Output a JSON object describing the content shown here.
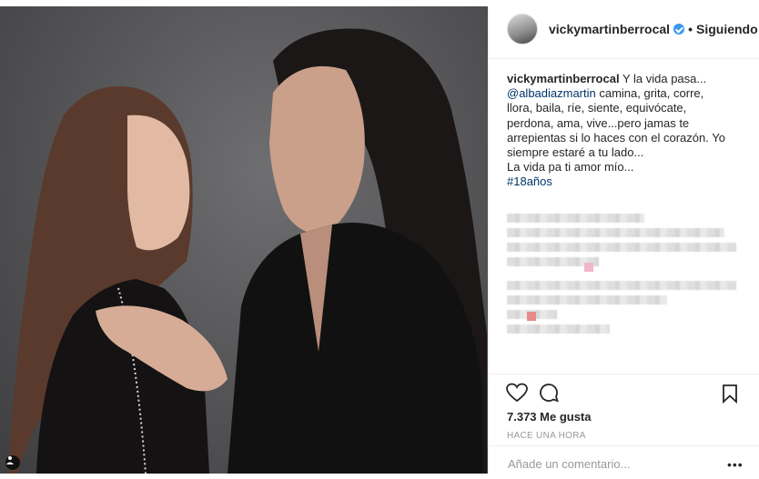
{
  "post": {
    "username": "vickymartinberrocal",
    "follow_label": "Siguiendo",
    "dot": "•",
    "caption": {
      "username": "vickymartinberrocal",
      "lines": [
        " Y la vida pasa...",
        "@albadiazmartin",
        " camina, grita, corre,",
        "llora, baila, ríe, siente, equivócate,",
        "perdona, ama, vive...pero jamas te",
        "arrepientas si lo haces con el corazón. Yo",
        "siempre estaré a tu lado...",
        "La vida pa ti amor mío...",
        "#18años"
      ]
    },
    "likes": "7.373 Me gusta",
    "timestamp": "HACE UNA HORA",
    "comment_placeholder": "Añade un comentario...",
    "more_label": "•••"
  },
  "icons": {
    "verified": "verified-badge-icon",
    "like": "heart-icon",
    "comment": "comment-bubble-icon",
    "save": "bookmark-icon",
    "user_tag": "user-tag-icon"
  },
  "colors": {
    "link": "#003569",
    "muted": "#999999",
    "verified": "#3897f0",
    "text": "#262626"
  }
}
